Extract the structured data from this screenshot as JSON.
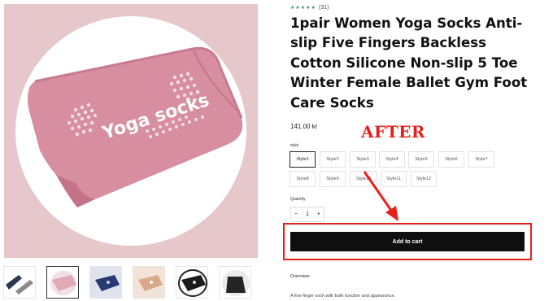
{
  "product": {
    "rating_stars": "★★★★★",
    "review_count": "(31)",
    "title": "1pair Women Yoga Socks Anti-slip Five Fingers Backless Cotton Silicone Non-slip 5 Toe Winter Female Ballet Gym Foot Care Socks",
    "price": "141.00 kr",
    "image_text": "Yoga socks"
  },
  "annotation": {
    "label": "AFTER",
    "color": "#e8201c"
  },
  "options": {
    "label": "style",
    "selected": "Style1",
    "styles": [
      "Style1",
      "Style2",
      "Style3",
      "Style4",
      "Style5",
      "Style6",
      "Style7",
      "Style8",
      "Style9",
      "Style10",
      "Style11",
      "Style12"
    ]
  },
  "quantity": {
    "label": "Quantity",
    "minus": "−",
    "value": "1",
    "plus": "+"
  },
  "cart": {
    "label": "Add to cart"
  },
  "overview": {
    "heading": "Overview:",
    "text": "A five-finger sock with both function and appearance."
  },
  "thumbnails": {
    "count": 6,
    "active_index": 1,
    "colors": [
      "#2a3550",
      "#e7b9c3",
      "#283a73",
      "#d9a98a",
      "#1b1b1b",
      "#242424"
    ]
  },
  "colors": {
    "accent_red": "#e8201c",
    "button_bg": "#0f0f0f",
    "image_bg": "#e6c7ca",
    "sock_pink": "#d58b9c",
    "star_green": "#3a8a6b"
  }
}
